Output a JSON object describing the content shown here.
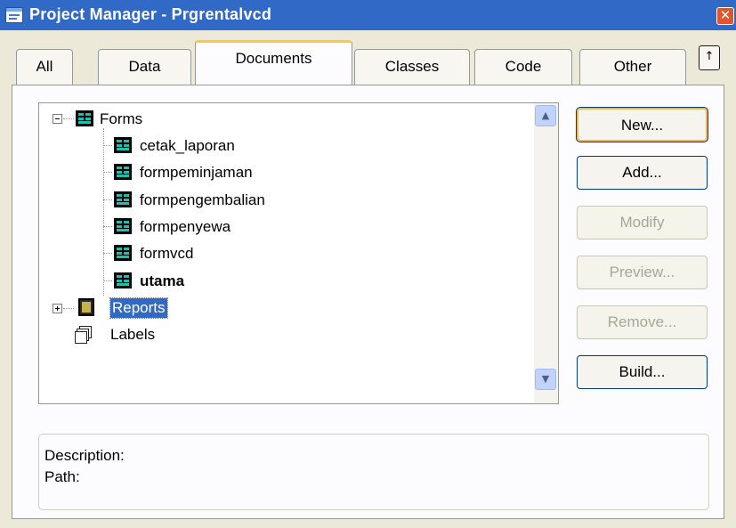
{
  "window": {
    "title": "Project Manager - Prgrentalvcd",
    "close_glyph": "✕"
  },
  "tabs": [
    {
      "label": "All"
    },
    {
      "label": "Data"
    },
    {
      "label": "Documents",
      "active": true
    },
    {
      "label": "Classes"
    },
    {
      "label": "Code"
    },
    {
      "label": "Other"
    }
  ],
  "tab_scroll_glyph": "↑",
  "tree": {
    "forms": {
      "label": "Forms",
      "expanded": true,
      "children": [
        "cetak_laporan",
        "formpeminjaman",
        "formpengembalian",
        "formpenyewa",
        "formvcd",
        "utama"
      ]
    },
    "reports": {
      "label": "Reports",
      "expanded": false,
      "selected": true
    },
    "labels": {
      "label": "Labels"
    }
  },
  "scrollbar": {
    "up_glyph": "▲",
    "down_glyph": "▼"
  },
  "buttons": {
    "new": "New...",
    "add": "Add...",
    "modify": "Modify",
    "preview": "Preview...",
    "remove": "Remove...",
    "build": "Build..."
  },
  "description": {
    "description_label": "Description:",
    "path_label": "Path:"
  },
  "colors": {
    "titlebar": "#3169C6",
    "window_bg": "#ECE9D8",
    "selection": "#316AC5",
    "active_tab_accent": "#FFC83C"
  }
}
